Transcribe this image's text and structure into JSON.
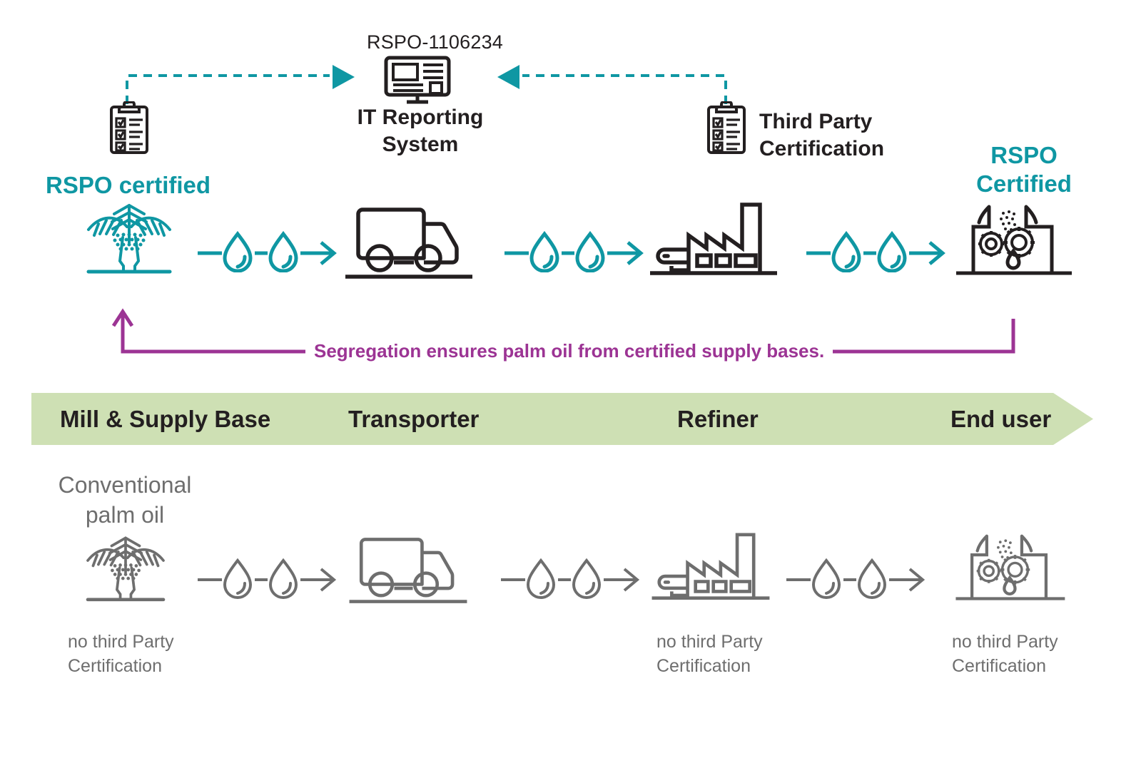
{
  "diagram": {
    "title_hidden": "",
    "colors": {
      "teal": "#0f97a3",
      "dark": "#231f20",
      "grey": "#6e6e6e",
      "purple": "#9c3494",
      "banner_green": "#cee0b4"
    }
  },
  "top": {
    "certificate_id": "RSPO-1106234",
    "it_system_label": "IT Reporting\nSystem",
    "third_party_label": "Third Party\nCertification",
    "left_clipboard_icon": "clipboard-checklist-icon",
    "right_clipboard_icon": "clipboard-checklist-icon",
    "monitor_icon": "monitor-report-icon",
    "arrow_left_to_system": "dashed-arrow-right",
    "arrow_right_to_system": "dashed-arrow-left"
  },
  "certified_chain": {
    "source_label": "RSPO certified",
    "end_label": "RSPO\nCertified",
    "nodes": [
      {
        "name": "palm-tree-icon",
        "label": "RSPO certified"
      },
      {
        "name": "truck-icon",
        "label": ""
      },
      {
        "name": "factory-icon",
        "label": ""
      },
      {
        "name": "processing-plant-icon",
        "label": "RSPO Certified"
      }
    ],
    "connectors": [
      {
        "name": "oil-droplet-flow-arrow"
      },
      {
        "name": "oil-droplet-flow-arrow"
      },
      {
        "name": "oil-droplet-flow-arrow"
      }
    ]
  },
  "segregation": {
    "note": "Segregation ensures palm oil from certified supply bases."
  },
  "stage_banner": {
    "stages": [
      {
        "label": "Mill & Supply Base"
      },
      {
        "label": "Transporter"
      },
      {
        "label": "Refiner"
      },
      {
        "label": "End user"
      }
    ]
  },
  "conventional_chain": {
    "source_label": "Conventional\npalm oil",
    "nodes": [
      {
        "name": "palm-tree-icon",
        "caption": "no third Party\nCertification"
      },
      {
        "name": "truck-icon",
        "caption": ""
      },
      {
        "name": "factory-icon",
        "caption": "no third Party\nCertification"
      },
      {
        "name": "processing-plant-icon",
        "caption": "no third Party\nCertification"
      }
    ],
    "connectors": [
      {
        "name": "oil-droplet-flow-arrow"
      },
      {
        "name": "oil-droplet-flow-arrow"
      },
      {
        "name": "oil-droplet-flow-arrow"
      }
    ]
  }
}
